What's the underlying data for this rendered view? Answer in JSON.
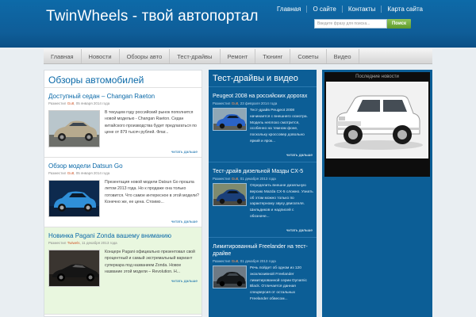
{
  "header": {
    "site_title": "TwinWheels - твой автопортал",
    "links": [
      "Главная",
      "О сайте",
      "Контакты",
      "Карта сайта"
    ],
    "search_placeholder": "Введите фразу для поиска...",
    "search_button": "Поиск"
  },
  "nav": {
    "items": [
      "Главная",
      "Новости",
      "Обзоры авто",
      "Тест-драйвы",
      "Ремонт",
      "Тюнинг",
      "Советы",
      "Видео"
    ]
  },
  "reviews": {
    "title": "Обзоры автомобилей",
    "posts": [
      {
        "title": "Доступный седан – Changan Raeton",
        "meta_prefix": "Разместил",
        "author": "Gu8",
        "date": "05 января 2014 года",
        "text": "В текущем году российский рынок пополнится новой моделью - Changan Raeton. Седан китайского производства будет предлагаться по цене от 879 тысяч рублей. Флаг...",
        "more": "читать дальше"
      },
      {
        "title": "Обзор модели Datsun Go",
        "meta_prefix": "Разместил",
        "author": "Gu8",
        "date": "05 января 2014 года",
        "text": "Презентация новой модели Datsun Go прошла летом 2013 года. Но к продаже она только готовится. Что самое интересное в этой модели? Конечно же, ее цена. Стоимо...",
        "more": "читать дальше"
      },
      {
        "title": "Новинка Pagani Zonda вашему вниманию",
        "meta_prefix": "Разместил",
        "author": "Twiwels",
        "date": "11 декабря 2013 года",
        "text": "Концерн Pagani официально презентовал свой процентный и самый экстремальный вариант суперкара под названием Zonda. Новое название этой модели – Revolution. Н...",
        "more": "читать дальше"
      }
    ]
  },
  "testdrives": {
    "title": "Тест-драйвы и видео",
    "posts": [
      {
        "title": "Peugeot 2008 на российских дорогах",
        "meta_prefix": "Разместил",
        "author": "Gu8",
        "date": "23 февраля 2014 года",
        "text": "Тест-драйв Peugeot 2008 начинается с внешнего осмотра. Модель неплохо смотрится, особенно на темном фоне, поскольку кроссовер довольно яркий и ярок...",
        "more": "читать дальше"
      },
      {
        "title": "Тест-драйв дизельной Мазды CX-5",
        "meta_prefix": "Разместил",
        "author": "Gu8",
        "date": "01 декабря 2013 года",
        "text": "Определить внешне дизельную версию Mazda CX-5 сложно. Узнать об этом можно только по характерному звуку двигателя. Шильдиков и надписей с обозначе...",
        "more": "читать дальше"
      },
      {
        "title": "Лимитированный Freelander на тест-драйве",
        "meta_prefix": "Разместил",
        "author": "Gu8",
        "date": "01 декабря 2013 года",
        "text": "Речь пойдет об одном из 120 эксклюзивной Freelander лимитированной серии Dynamic Black. Отличается данная спецверсия от остальных Freelander обвесом...",
        "more": "читать дальше"
      }
    ]
  },
  "latest_news": {
    "label": "Последние новости"
  },
  "colors": {
    "header_blue": "#0f5d98",
    "link_blue": "#0a69a8",
    "accent_orange": "#d0572a",
    "search_green": "#6ea83a"
  }
}
